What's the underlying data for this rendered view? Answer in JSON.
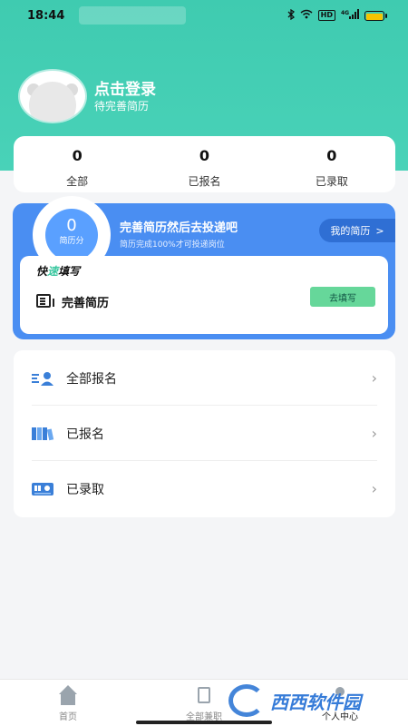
{
  "status_bar": {
    "time": "18:44",
    "icons": [
      "bluetooth-icon",
      "wifi-icon",
      "hd-icon",
      "4g-signal-icon",
      "battery-icon"
    ],
    "hd_label": "HD",
    "network_label": "4G"
  },
  "profile": {
    "login_text": "点击登录",
    "subtitle": "待完善简历"
  },
  "stats": [
    {
      "value": "0",
      "label": "全部"
    },
    {
      "value": "0",
      "label": "已报名"
    },
    {
      "value": "0",
      "label": "已录取"
    }
  ],
  "resume": {
    "score_value": "0",
    "score_label": "简历分",
    "title": "完善简历然后去投递吧",
    "subtitle": "简历完成100%才可投递岗位",
    "my_resume_button": "我的简历",
    "my_resume_chevron": ">",
    "quick_fill_title_part1": "快",
    "quick_fill_title_accent": "速",
    "quick_fill_title_part2": "填写",
    "complete_resume_label": "完善简历",
    "fill_button": "去填写"
  },
  "menu": {
    "items": [
      {
        "label": "全部报名",
        "icon": "all-signup-icon"
      },
      {
        "label": "已报名",
        "icon": "signed-up-icon"
      },
      {
        "label": "已录取",
        "icon": "admitted-icon"
      }
    ],
    "chevron": "›"
  },
  "bottom_nav": {
    "items": [
      {
        "label": "首页",
        "icon": "home-icon"
      },
      {
        "label": "全部兼职",
        "icon": "jobs-icon"
      },
      {
        "label": "个人中心",
        "icon": "profile-icon"
      }
    ]
  },
  "watermark": {
    "text": "西西软件园",
    "subtext": "CR173.COM"
  },
  "colors": {
    "header_green": "#49d2b8",
    "resume_blue": "#4a8ef2",
    "fill_button_green": "#66d79a"
  }
}
